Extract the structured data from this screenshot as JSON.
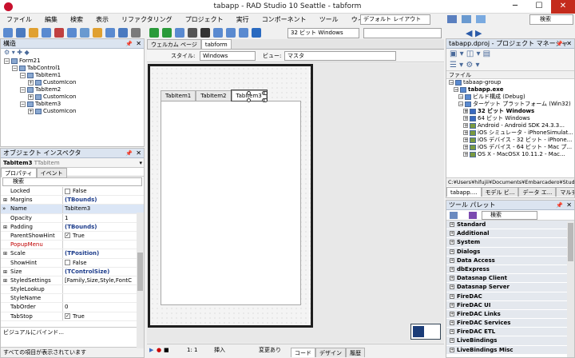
{
  "window": {
    "title": "tabapp - RAD Studio 10 Seattle - tabform",
    "min": "─",
    "max": "☐",
    "close": "✕"
  },
  "menu": [
    "ファイル",
    "編集",
    "検索",
    "表示",
    "リファクタリング",
    "プロジェクト",
    "実行",
    "コンポーネント",
    "ツール",
    "ウィンドウ",
    "ヘルプ"
  ],
  "layout_select": "デフォルト レイアウト",
  "search_placeholder": "検索",
  "structure": {
    "title": "構造",
    "tree": [
      {
        "label": "Form21",
        "depth": 0
      },
      {
        "label": "TabControl1",
        "depth": 1
      },
      {
        "label": "TabItem1",
        "depth": 2
      },
      {
        "label": "CustomIcon",
        "depth": 3
      },
      {
        "label": "TabItem2",
        "depth": 2
      },
      {
        "label": "CustomIcon",
        "depth": 3
      },
      {
        "label": "TabItem3",
        "depth": 2
      },
      {
        "label": "CustomIcon",
        "depth": 3
      }
    ]
  },
  "inspector": {
    "title": "オブジェクト インスペクタ",
    "object": "TabItem3",
    "object_type": "TTabItem",
    "tabs": [
      "プロパティ",
      "イベント"
    ],
    "search": "検索",
    "rows": [
      {
        "n": "Locked",
        "v": "False",
        "cb": "off"
      },
      {
        "n": "Margins",
        "v": "(TBounds)",
        "b": 1,
        "ex": 1
      },
      {
        "n": "Name",
        "v": "TabItem3",
        "sel": 1
      },
      {
        "n": "Opacity",
        "v": "1"
      },
      {
        "n": "Padding",
        "v": "(TBounds)",
        "b": 1,
        "ex": 1
      },
      {
        "n": "ParentShowHint",
        "v": "True",
        "cb": "on"
      },
      {
        "n": "PopupMenu",
        "v": "",
        "red": 1
      },
      {
        "n": "Scale",
        "v": "(TPosition)",
        "b": 1,
        "ex": 1
      },
      {
        "n": "ShowHint",
        "v": "False",
        "cb": "off"
      },
      {
        "n": "Size",
        "v": "(TControlSize)",
        "b": 1,
        "ex": 1
      },
      {
        "n": "StyledSettings",
        "v": "[Family,Size,Style,FontC",
        "ex": 1
      },
      {
        "n": "StyleLookup",
        "v": ""
      },
      {
        "n": "StyleName",
        "v": ""
      },
      {
        "n": "TabOrder",
        "v": "0"
      },
      {
        "n": "TabStop",
        "v": "True",
        "cb": "on"
      }
    ],
    "footer": "ビジュアルにバインド...",
    "status": "すべての項目が表示されています"
  },
  "doc_tabs": [
    "ウェルカム ページ",
    "tabform"
  ],
  "designer": {
    "style_label": "スタイル:",
    "style_value": "Windows",
    "view_label": "ビュー:",
    "view_value": "マスタ",
    "tab_items": [
      "TabItem1",
      "TabItem2",
      "TabItem3"
    ]
  },
  "statusbar": {
    "position": "1:  1",
    "mode": "挿入",
    "modified": "変更あり",
    "tabs": [
      "コード",
      "デザイン",
      "履歴"
    ]
  },
  "project": {
    "title": "tabapp.dproj - プロジェクト マネージャ",
    "file_label": "ファイル",
    "tree": [
      {
        "label": "tabaap-group",
        "d": 0
      },
      {
        "label": "tabapp.exe",
        "d": 1,
        "b": 1
      },
      {
        "label": "ビルド構成 (Debug)",
        "d": 2
      },
      {
        "label": "ターゲット プラットフォーム (Win32)",
        "d": 2
      },
      {
        "label": "32 ビット Windows",
        "d": 3,
        "b": 1
      },
      {
        "label": "64 ビット Windows",
        "d": 3
      },
      {
        "label": "Android - Android SDK 24.3.3...",
        "d": 3
      },
      {
        "label": "iOS シミュレータ - iPhoneSimulat...",
        "d": 3
      },
      {
        "label": "iOS デバイス - 32 ビット - iPhone...",
        "d": 3
      },
      {
        "label": "iOS デバイス - 64 ビット - Mac プ...",
        "d": 3
      },
      {
        "label": "OS X - MacOSX 10.11.2 - Mac...",
        "d": 3
      }
    ],
    "path": "C:¥Users¥hifujii¥Documents¥Embarcadero¥Stud",
    "tabs": [
      "tabapp....",
      "モデル ビ...",
      "データ エ...",
      "マルチデ..."
    ]
  },
  "toolbar": {
    "platform": "32 ビット Windows"
  },
  "palette": {
    "title": "ツール パレット",
    "search": "検索",
    "cats": [
      "Standard",
      "Additional",
      "System",
      "Dialogs",
      "Data Access",
      "dbExpress",
      "Datasnap Client",
      "Datasnap Server",
      "FireDAC",
      "FireDAC UI",
      "FireDAC Links",
      "FireDAC Services",
      "FireDAC ETL",
      "LiveBindings",
      "LiveBindings Misc"
    ]
  }
}
